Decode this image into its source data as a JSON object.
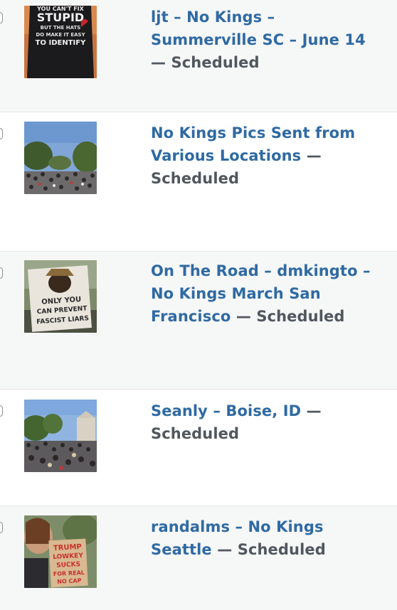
{
  "posts": [
    {
      "title": "ljt – No Kings – Summerville SC – June 14",
      "separator": "—",
      "state": "Scheduled",
      "thumb_icon": "protest-shirt-thumbnail"
    },
    {
      "title": "No Kings Pics Sent from Various Locations",
      "separator": "—",
      "state": "Scheduled",
      "thumb_icon": "crowd-thumbnail"
    },
    {
      "title": "On The Road – dmkingto – No Kings March San Francisco",
      "separator": "—",
      "state": "Scheduled",
      "thumb_icon": "smokey-sign-thumbnail"
    },
    {
      "title": "Seanly – Boise, ID",
      "separator": "—",
      "state": "Scheduled",
      "thumb_icon": "crowd-capitol-thumbnail"
    },
    {
      "title": "randalms – No Kings Seattle",
      "separator": "—",
      "state": "Scheduled",
      "thumb_icon": "trump-sign-thumbnail"
    }
  ],
  "thumbnail_text": {
    "shirt_lines": [
      "YOU CAN'T FIX",
      "STUPID",
      "BUT THE HATS",
      "DO MAKE IT EASY",
      "TO IDENTIFY"
    ],
    "smokey_lines": [
      "ONLY YOU",
      "CAN PREVENT",
      "FASCIST LIARS"
    ],
    "trump_lines": [
      "TRUMP",
      "LOWKEY",
      "SUCKS",
      "FOR REAL",
      "NO CAP"
    ]
  },
  "colors": {
    "link": "#2f6aa3",
    "state": "#50575e",
    "alt_row": "#f6f7f7"
  }
}
